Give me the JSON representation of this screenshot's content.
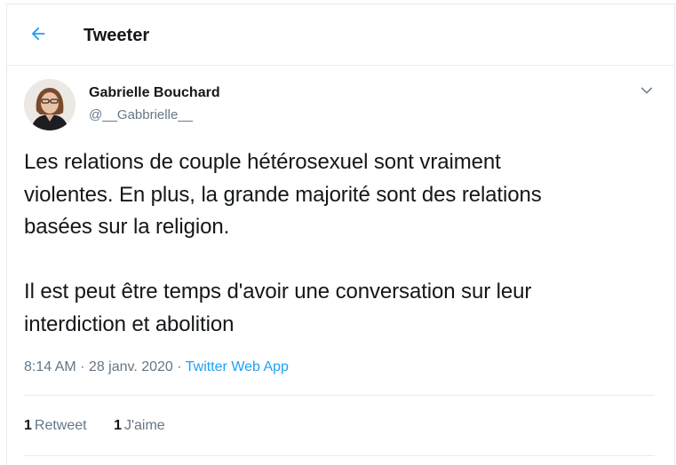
{
  "header": {
    "title": "Tweeter",
    "back_icon": "arrow-left-icon"
  },
  "tweet": {
    "author_name": "Gabrielle Bouchard",
    "author_handle": "@__Gabbrielle__",
    "text": "Les relations de couple hétérosexuel sont vraiment\nviolentes. En plus, la grande majorité sont des relations\nbasées sur la religion.\n\nIl est peut être temps d'avoir une conversation sur leur\ninterdiction et abolition",
    "time": "8:14 AM",
    "separator": " · ",
    "date": "28 janv. 2020",
    "source": "Twitter Web App"
  },
  "stats": {
    "retweets_count": "1",
    "retweets_label": "Retweet",
    "likes_count": "1",
    "likes_label": "J'aime"
  },
  "colors": {
    "accent": "#1da1f2",
    "text_primary": "#14171a",
    "text_secondary": "#657786",
    "border": "#e6ecf0"
  }
}
